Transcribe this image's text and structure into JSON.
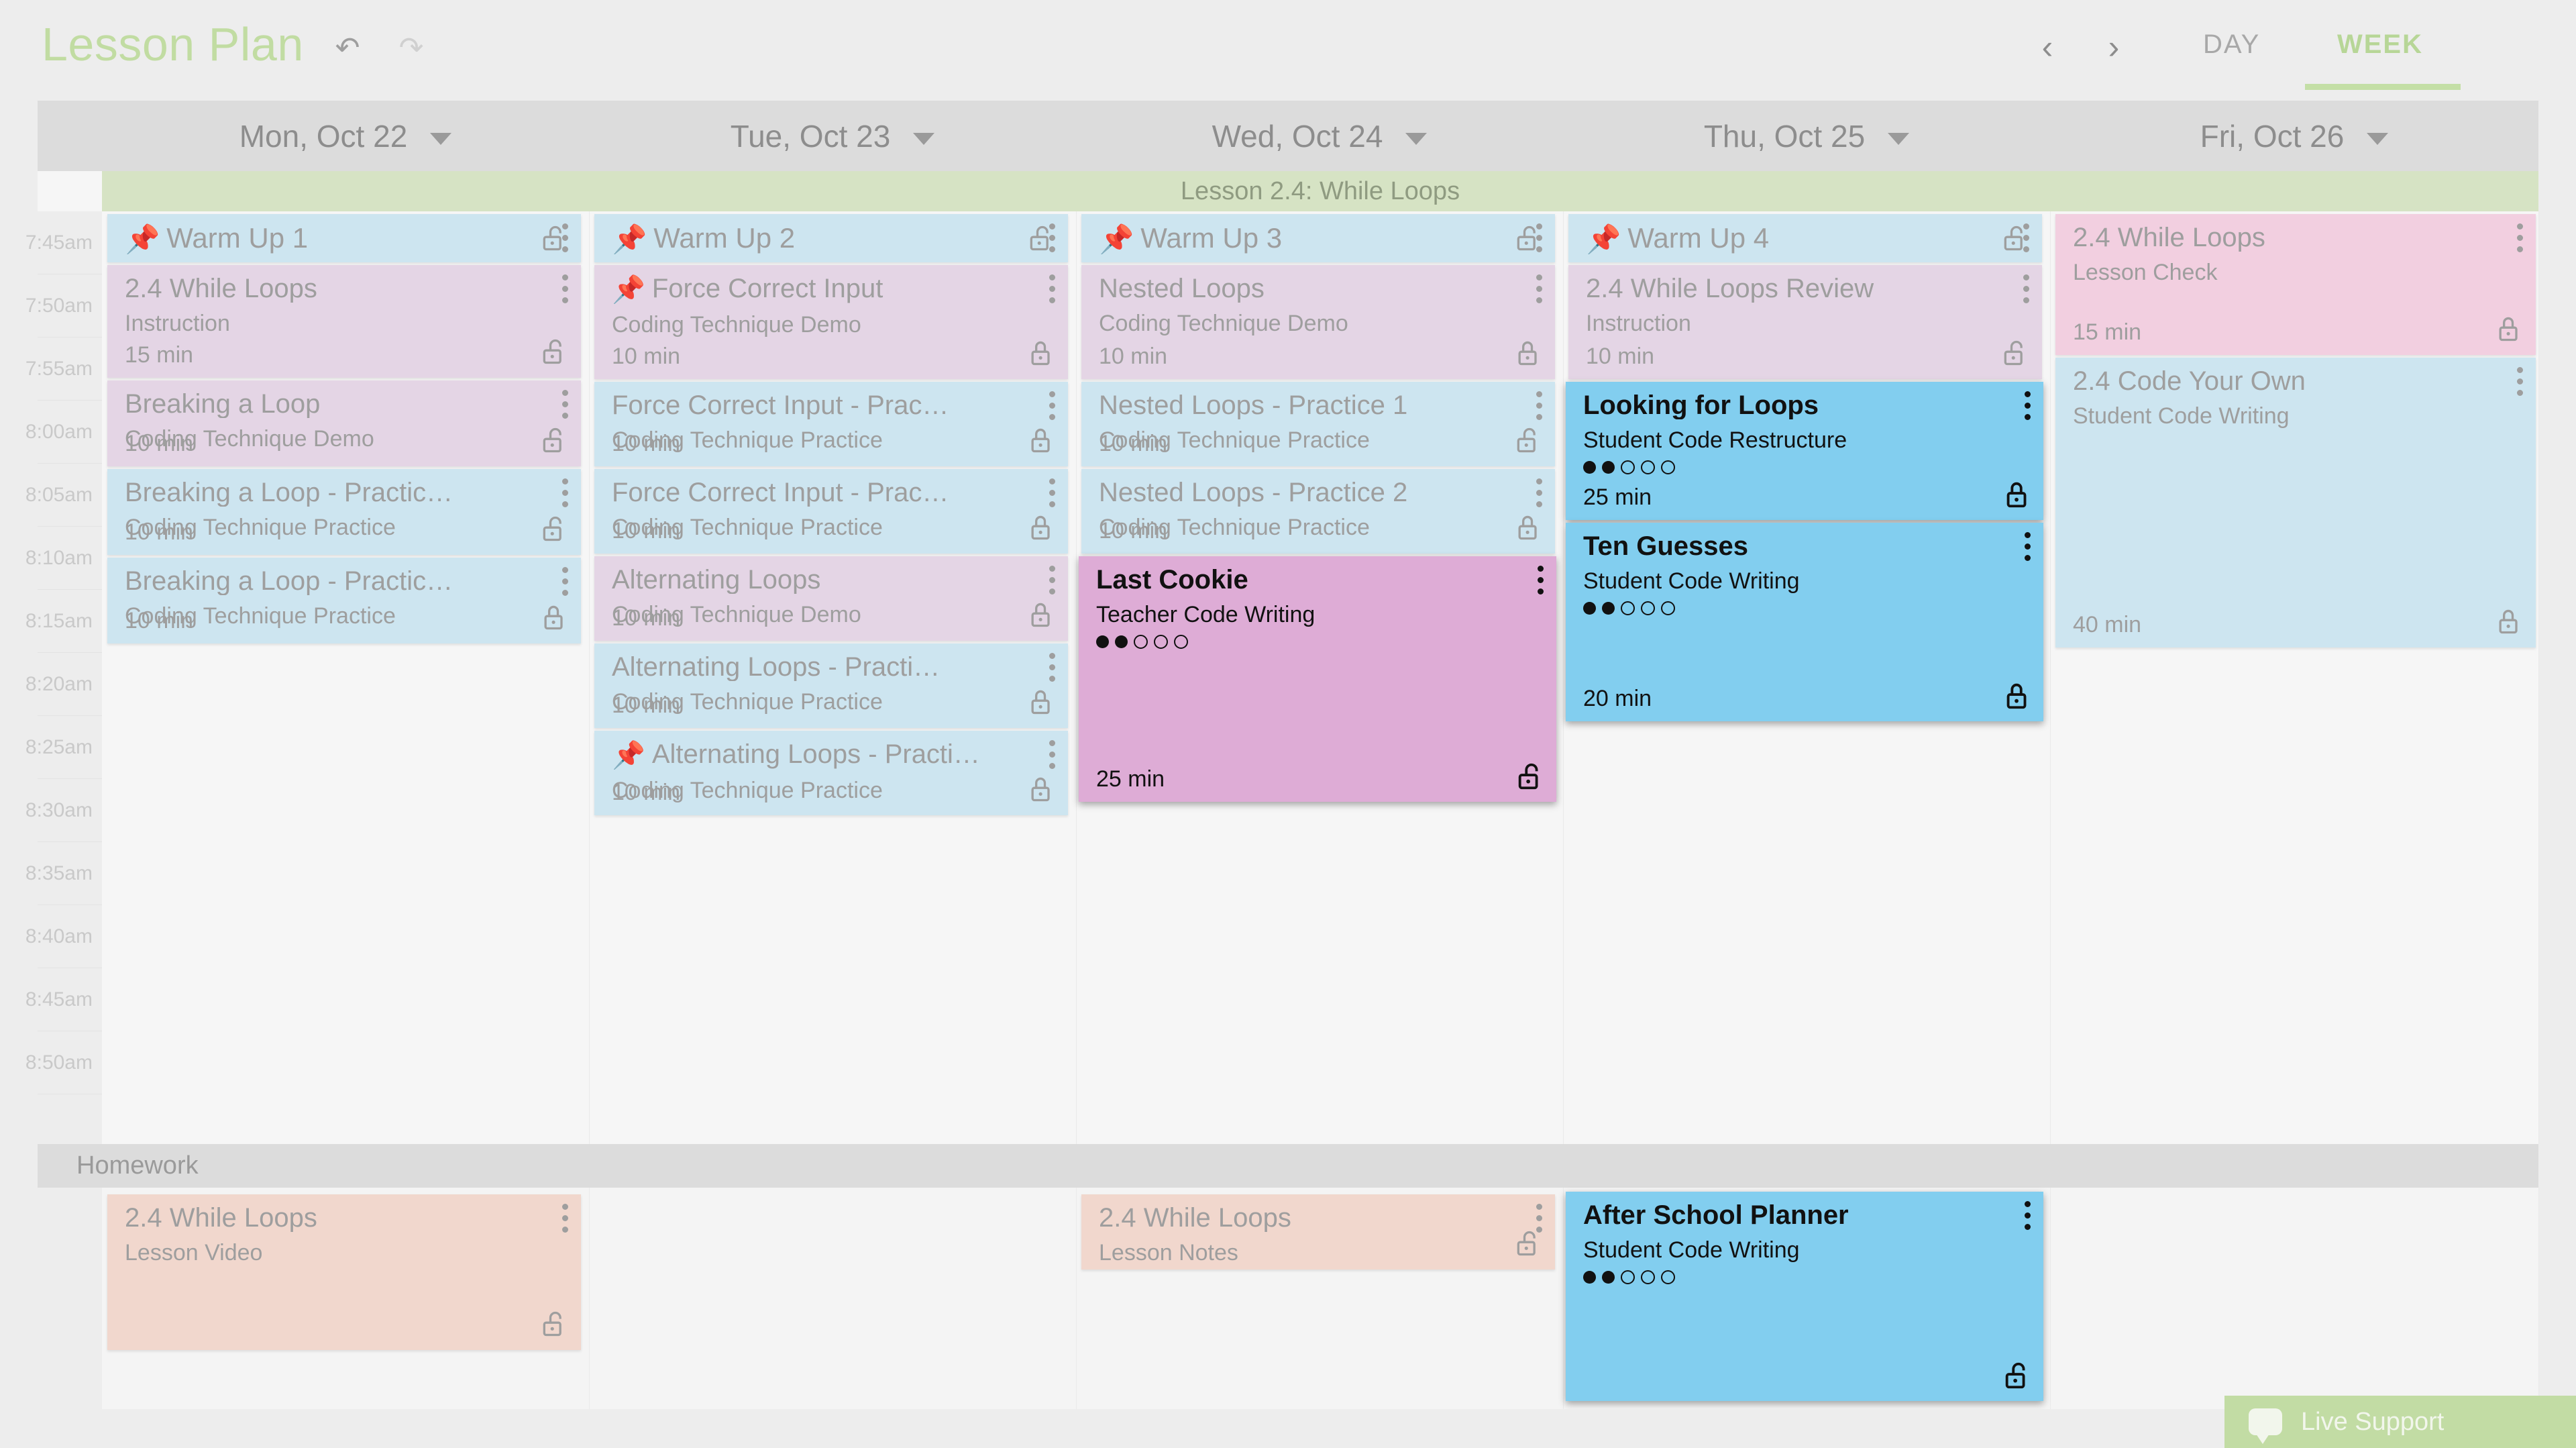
{
  "header": {
    "title": "Lesson Plan",
    "undo_icon": "undo-icon",
    "redo_icon": "redo-icon",
    "prev_icon": "chevron-left-icon",
    "next_icon": "chevron-right-icon",
    "tab_day": "DAY",
    "tab_week": "WEEK",
    "active_tab": "WEEK",
    "accent_green": "#c1dca2"
  },
  "lesson_band": {
    "label": "Lesson 2.4: While Loops"
  },
  "days": [
    {
      "label": "Mon, Oct 22"
    },
    {
      "label": "Tue, Oct 23"
    },
    {
      "label": "Wed, Oct 24"
    },
    {
      "label": "Thu, Oct 25"
    },
    {
      "label": "Fri, Oct 26"
    }
  ],
  "times": [
    "7:45am",
    "7:50am",
    "7:55am",
    "8:00am",
    "8:05am",
    "8:10am",
    "8:15am",
    "8:20am",
    "8:25am",
    "8:30am",
    "8:35am",
    "8:40am",
    "8:45am",
    "8:50am"
  ],
  "homework_band": {
    "label": "Homework"
  },
  "cards": {
    "mon_warmup": {
      "title": "Warm Up 1",
      "sub": "",
      "dur": "",
      "lock": "unlocked",
      "pinned": true
    },
    "mon_c1": {
      "title": "2.4 While Loops",
      "sub": "Instruction",
      "dur": "15 min",
      "lock": "unlocked",
      "pinned": false
    },
    "mon_c2": {
      "title": "Breaking a Loop",
      "sub": "Coding Technique Demo",
      "dur": "10 min",
      "lock": "unlocked",
      "pinned": false
    },
    "mon_c3": {
      "title": "Breaking a Loop - Practic…",
      "sub": "Coding Technique Practice",
      "dur": "10 min",
      "lock": "unlocked",
      "pinned": false
    },
    "mon_c4": {
      "title": "Breaking a Loop - Practic…",
      "sub": "Coding Technique Practice",
      "dur": "10 min",
      "lock": "locked",
      "pinned": false
    },
    "mon_hw": {
      "title": "2.4 While Loops",
      "sub": "Lesson Video",
      "dur": "",
      "lock": "unlocked",
      "pinned": false
    },
    "tue_warmup": {
      "title": "Warm Up 2",
      "sub": "",
      "dur": "",
      "lock": "unlocked",
      "pinned": true
    },
    "tue_c1": {
      "title": "Force Correct Input",
      "sub": "Coding Technique Demo",
      "dur": "10 min",
      "lock": "locked",
      "pinned": true
    },
    "tue_c2": {
      "title": "Force Correct Input - Prac…",
      "sub": "Coding Technique Practice",
      "dur": "10 min",
      "lock": "locked",
      "pinned": false
    },
    "tue_c3": {
      "title": "Force Correct Input - Prac…",
      "sub": "Coding Technique Practice",
      "dur": "10 min",
      "lock": "locked",
      "pinned": false
    },
    "tue_c4": {
      "title": "Alternating Loops",
      "sub": "Coding Technique Demo",
      "dur": "10 min",
      "lock": "locked",
      "pinned": false
    },
    "tue_c5": {
      "title": "Alternating Loops - Practi…",
      "sub": "Coding Technique Practice",
      "dur": "10 min",
      "lock": "locked",
      "pinned": false
    },
    "tue_c6": {
      "title": "Alternating Loops - Practi…",
      "sub": "Coding Technique Practice",
      "dur": "10 min",
      "lock": "locked",
      "pinned": true
    },
    "wed_warmup": {
      "title": "Warm Up 3",
      "sub": "",
      "dur": "",
      "lock": "unlocked",
      "pinned": true
    },
    "wed_c1": {
      "title": "Nested Loops",
      "sub": "Coding Technique Demo",
      "dur": "10 min",
      "lock": "locked",
      "pinned": false
    },
    "wed_c2": {
      "title": "Nested Loops - Practice 1",
      "sub": "Coding Technique Practice",
      "dur": "10 min",
      "lock": "unlocked",
      "pinned": false
    },
    "wed_c3": {
      "title": "Nested Loops - Practice 2",
      "sub": "Coding Technique Practice",
      "dur": "10 min",
      "lock": "locked",
      "pinned": false
    },
    "wed_c4": {
      "title": "Last Cookie",
      "sub": "Teacher Code Writing",
      "dur": "25 min",
      "lock": "unlocked",
      "pinned": false,
      "rating_filled": 2,
      "rating_total": 5
    },
    "wed_hw": {
      "title": "2.4 While Loops",
      "sub": "Lesson Notes",
      "dur": "",
      "lock": "unlocked",
      "pinned": false
    },
    "thu_warmup": {
      "title": "Warm Up 4",
      "sub": "",
      "dur": "",
      "lock": "unlocked",
      "pinned": true
    },
    "thu_c1": {
      "title": "2.4 While Loops Review",
      "sub": "Instruction",
      "dur": "10 min",
      "lock": "unlocked",
      "pinned": false
    },
    "thu_c2": {
      "title": "Looking for Loops",
      "sub": "Student Code Restructure",
      "dur": "25 min",
      "lock": "locked",
      "pinned": false,
      "rating_filled": 2,
      "rating_total": 5
    },
    "thu_c3": {
      "title": "Ten Guesses",
      "sub": "Student Code Writing",
      "dur": "20 min",
      "lock": "locked",
      "pinned": false,
      "rating_filled": 2,
      "rating_total": 5
    },
    "thu_hw": {
      "title": "After School Planner",
      "sub": "Student Code Writing",
      "dur": "",
      "lock": "unlocked",
      "pinned": false,
      "rating_filled": 2,
      "rating_total": 5
    },
    "fri_c1": {
      "title": "2.4 While Loops",
      "sub": "Lesson Check",
      "dur": "15 min",
      "lock": "locked",
      "pinned": false
    },
    "fri_c2": {
      "title": "2.4 Code Your Own",
      "sub": "Student Code Writing",
      "dur": "40 min",
      "lock": "locked",
      "pinned": false
    }
  },
  "support": {
    "label": "Live Support",
    "icon": "chat-bubble-icon",
    "color": "#c2dca4"
  }
}
